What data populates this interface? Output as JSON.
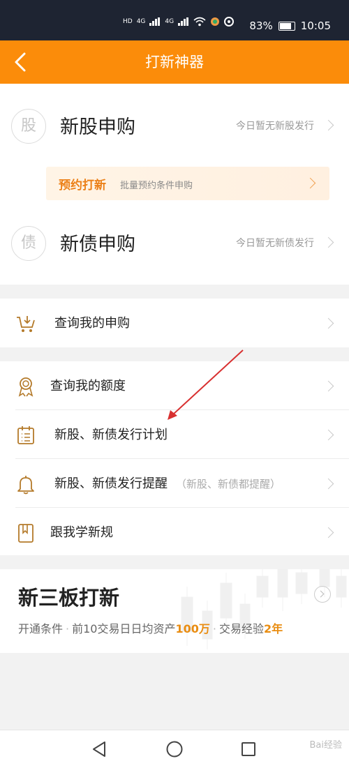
{
  "status_bar": {
    "battery": "83%",
    "time": "10:05",
    "net_a": "4G",
    "net_b": "4G"
  },
  "header": {
    "title": "打新神器"
  },
  "ipo": {
    "stock": {
      "badge": "股",
      "title": "新股申购",
      "hint": "今日暂无新股发行"
    },
    "reserve": {
      "label": "预约打新",
      "sub": "批量预约条件申购"
    },
    "bond": {
      "badge": "债",
      "title": "新债申购",
      "hint": "今日暂无新债发行"
    }
  },
  "menu": {
    "my_subscriptions": "查询我的申购",
    "my_quota": "查询我的额度",
    "issue_plan": "新股、新债发行计划",
    "issue_reminder": "新股、新债发行提醒",
    "issue_reminder_extra": "（新股、新债都提醒）",
    "learn_rules": "跟我学新规"
  },
  "neeq": {
    "title": "新三板打新",
    "cond_label": "开通条件",
    "cond1_prefix": "前10交易日日均资产",
    "cond1_value": "100万",
    "cond2_prefix": "交易经验",
    "cond2_value": "2年"
  },
  "watermark": "Bai经验",
  "colors": {
    "accent": "#fb8c0a",
    "status_bar": "#1e2432",
    "highlight": "#e98d12",
    "annotation_arrow": "#d83030"
  }
}
